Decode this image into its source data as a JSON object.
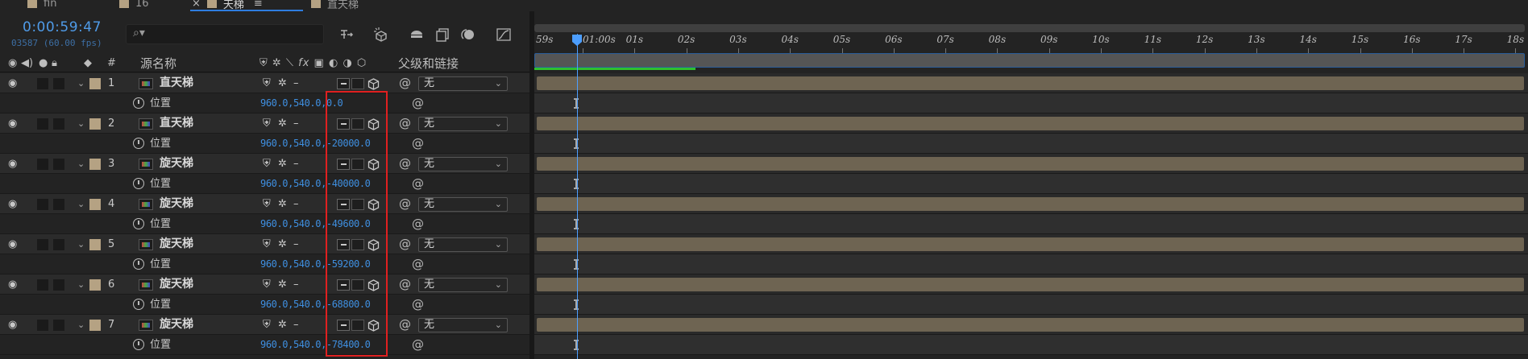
{
  "tabs": [
    {
      "label": "fin",
      "active": false
    },
    {
      "label": "16",
      "active": false
    },
    {
      "label": "天梯",
      "active": true
    },
    {
      "label": "直天梯",
      "active": false
    }
  ],
  "header": {
    "timecode": "0:00:59:47",
    "frame_info": "03587 (60.00 fps)",
    "search_placeholder": ""
  },
  "columns": {
    "number": "#",
    "source_name": "源名称",
    "parent_link": "父级和链接"
  },
  "layers": [
    {
      "index": "1",
      "name": "直天梯",
      "parent": "无",
      "prop_name": "位置",
      "value_prefix": "960.0,540.0,",
      "value_z": "0.0"
    },
    {
      "index": "2",
      "name": "直天梯",
      "parent": "无",
      "prop_name": "位置",
      "value_prefix": "960.0,540.0,",
      "value_z": "-20000.0"
    },
    {
      "index": "3",
      "name": "旋天梯",
      "parent": "无",
      "prop_name": "位置",
      "value_prefix": "960.0,540.0,",
      "value_z": "-40000.0"
    },
    {
      "index": "4",
      "name": "旋天梯",
      "parent": "无",
      "prop_name": "位置",
      "value_prefix": "960.0,540.0,",
      "value_z": "-49600.0"
    },
    {
      "index": "5",
      "name": "旋天梯",
      "parent": "无",
      "prop_name": "位置",
      "value_prefix": "960.0,540.0,",
      "value_z": "-59200.0"
    },
    {
      "index": "6",
      "name": "旋天梯",
      "parent": "无",
      "prop_name": "位置",
      "value_prefix": "960.0,540.0,",
      "value_z": "-68800.0"
    },
    {
      "index": "7",
      "name": "旋天梯",
      "parent": "无",
      "prop_name": "位置",
      "value_prefix": "960.0,540.0,",
      "value_z": "-78400.0"
    }
  ],
  "ruler": {
    "labels": [
      "59s",
      "01:00s",
      "01s",
      "02s",
      "03s",
      "04s",
      "05s",
      "06s",
      "07s",
      "08s",
      "09s",
      "10s",
      "11s",
      "12s",
      "13s",
      "14s",
      "15s",
      "16s",
      "17s",
      "18s"
    ]
  },
  "colors": {
    "accent": "#2e7de0",
    "timecode": "#4f9be8",
    "value_blue": "#3f8fe0",
    "label_tan": "#b5a283",
    "layer_bar": "#6e6452",
    "highlight_red": "#e02020",
    "render_green": "#2fbf2f"
  },
  "icons": {
    "search": "search-icon",
    "stopwatch": "stopwatch-icon",
    "eye": "eye-icon",
    "pickwhip": "pickwhip-icon",
    "cube": "3d-layer-icon"
  }
}
